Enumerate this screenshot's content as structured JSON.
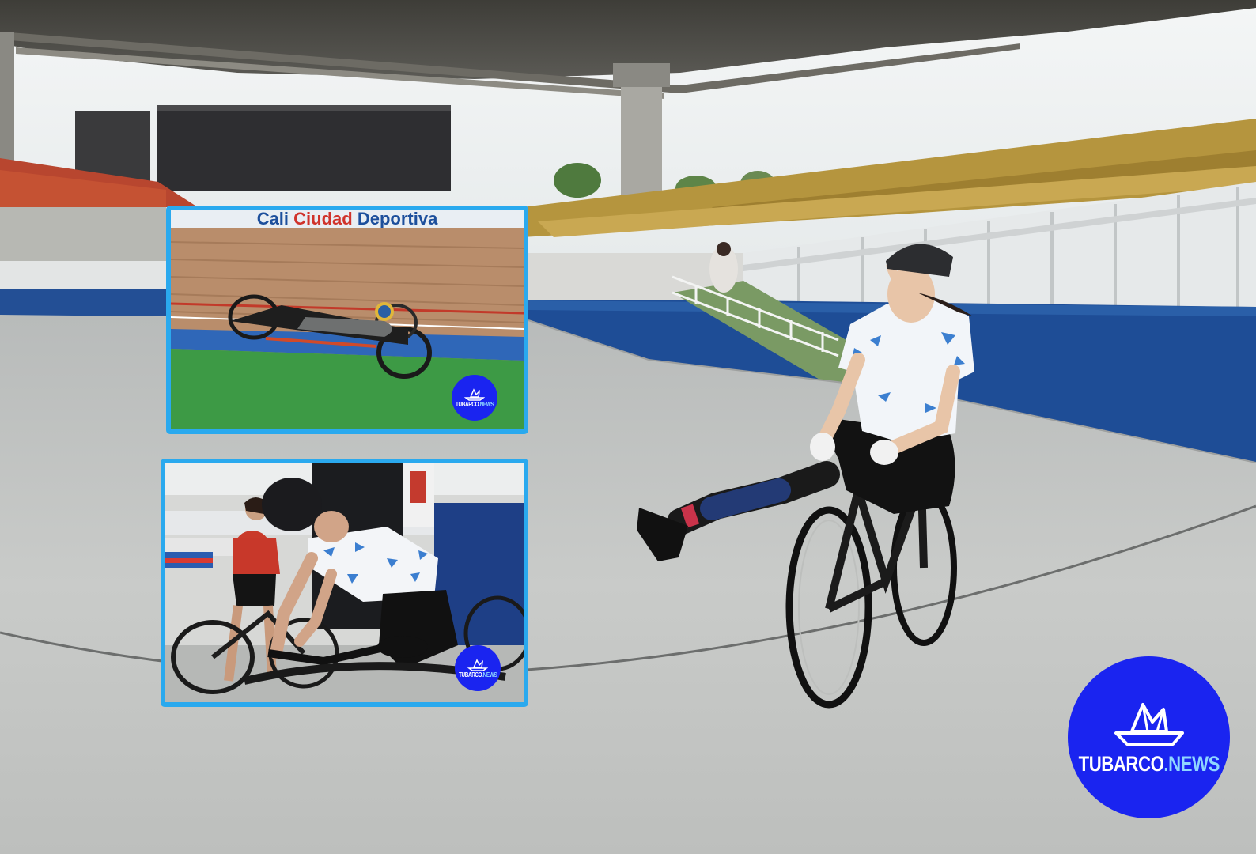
{
  "inset_top": {
    "banner_text_left": "Cali ",
    "banner_text_mid": "Ciudad",
    "banner_text_right": " Deportiva"
  },
  "logo": {
    "brand": "TUBARCO",
    "suffix": ".NEWS",
    "icon": "paper-boat-icon",
    "color_bg": "#1a24f0",
    "color_text": "#ffffff",
    "color_suffix": "#8fd6ff"
  },
  "frame_color": "#2aa9ee"
}
